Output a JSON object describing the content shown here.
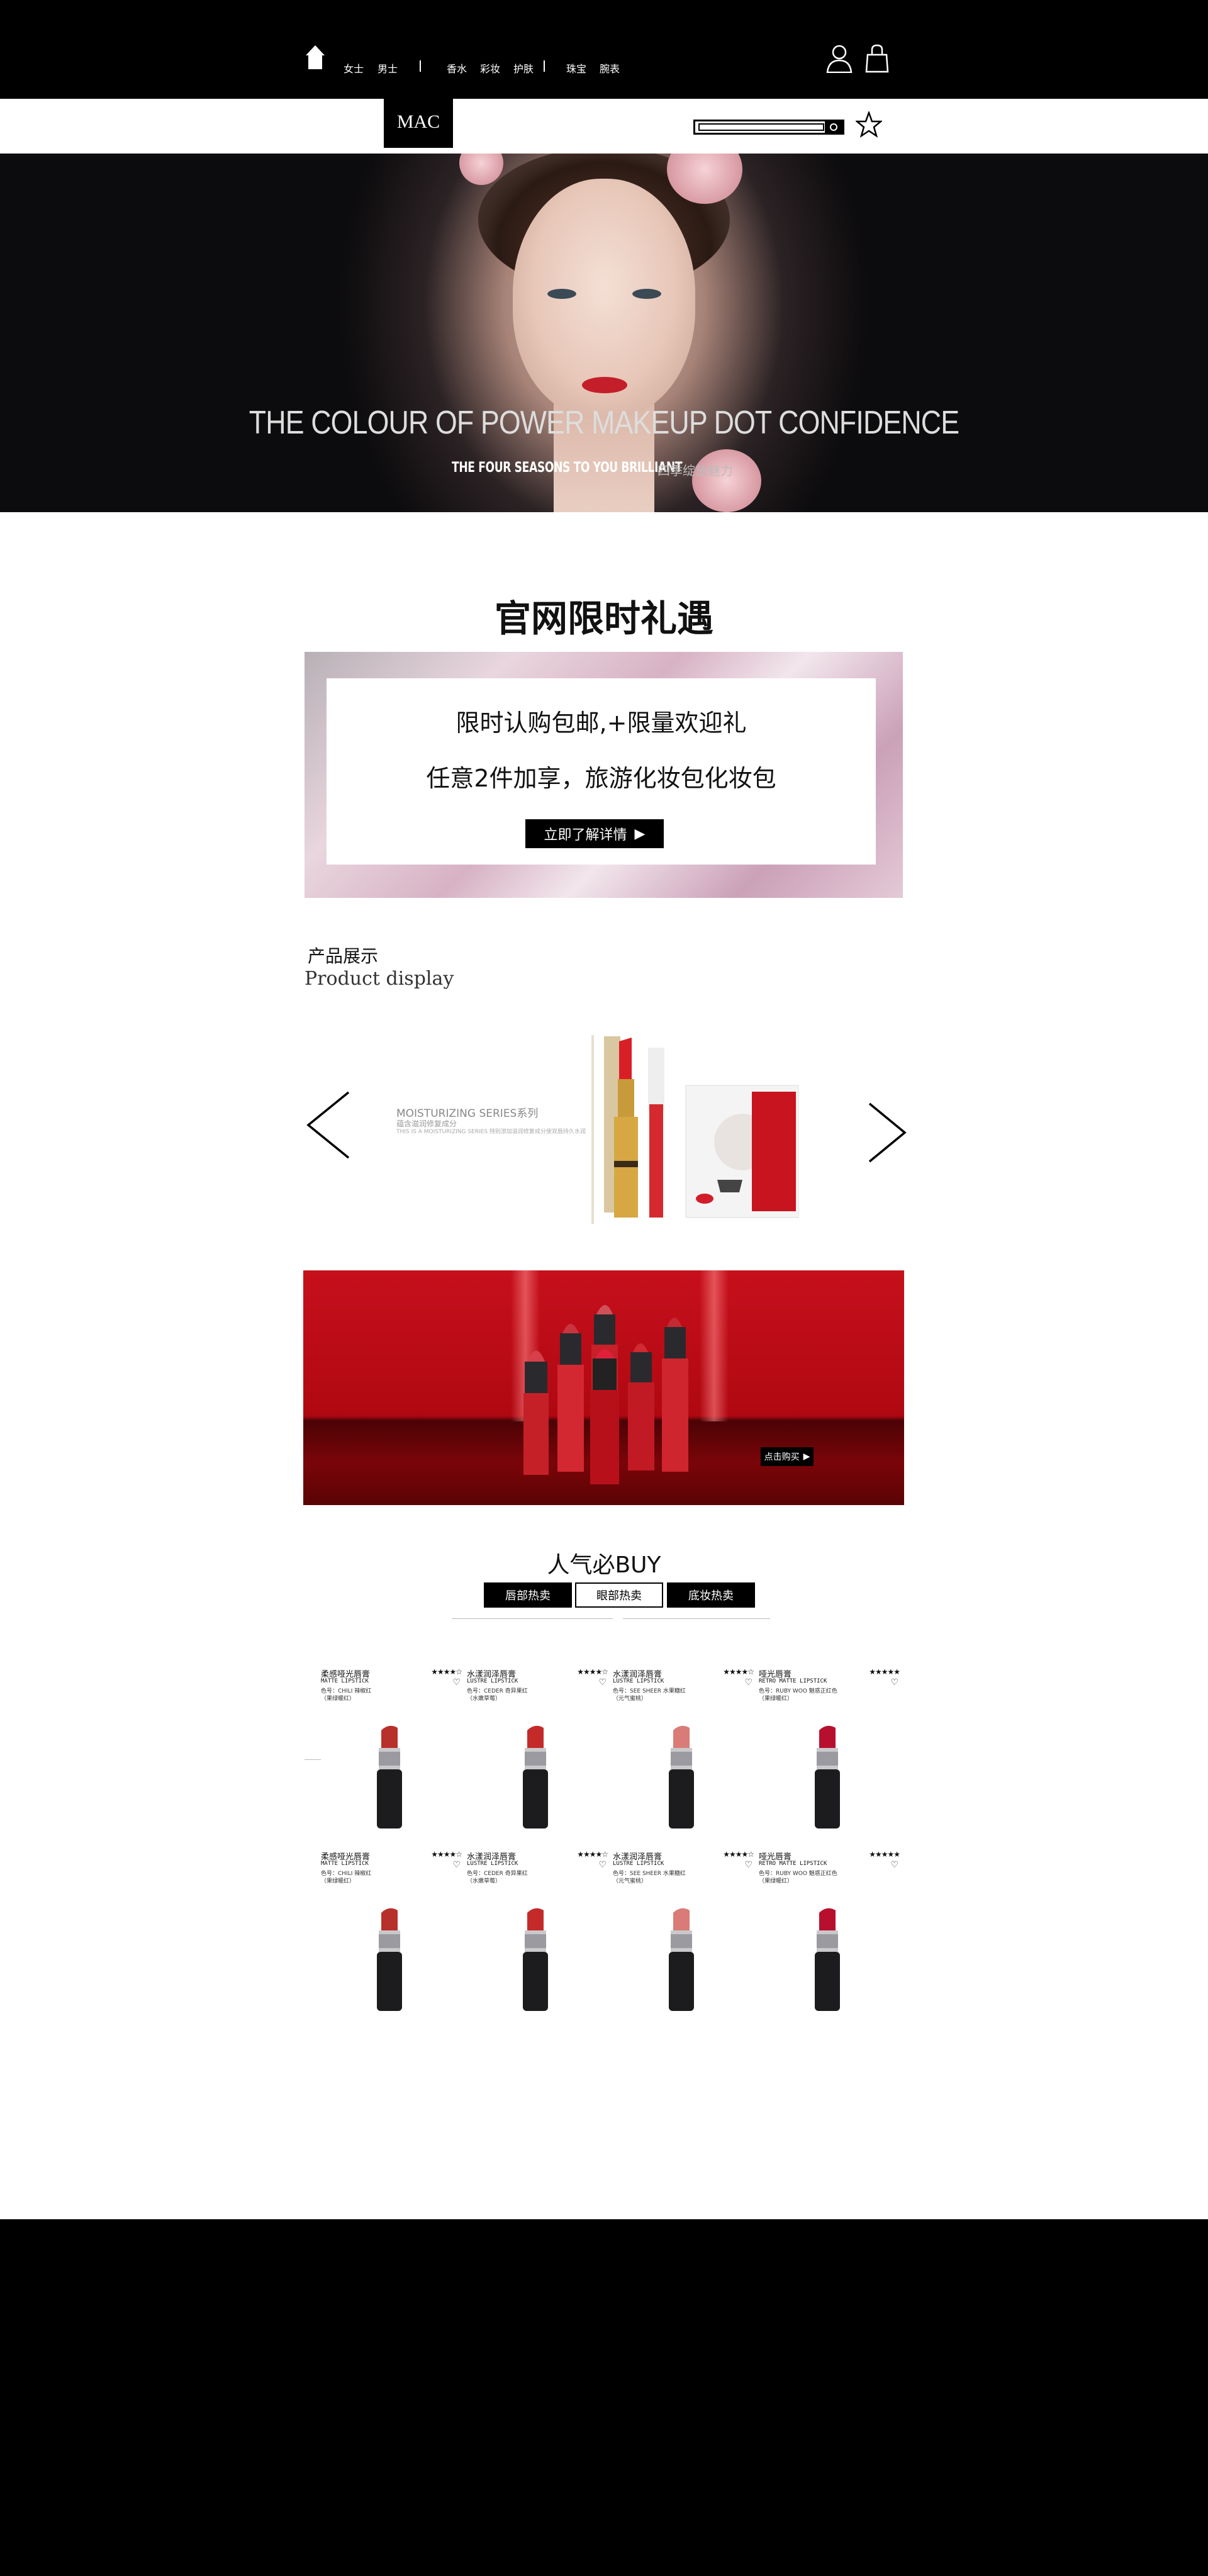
{
  "nav": {
    "women": "女士",
    "men": "男士",
    "perfume": "香水",
    "makeup": "彩妆",
    "skincare": "护肤",
    "jewelry": "珠宝",
    "watches": "腕表"
  },
  "header": {
    "logo": "MAC"
  },
  "hero": {
    "title": "THE COLOUR OF POWER MAKEUP DOT CONFIDENCE",
    "subtitle": "THE FOUR SEASONS TO YOU BRILLIANT",
    "subtitle_right": "四季绽放魅力"
  },
  "promo": {
    "title": "官网限时礼遇",
    "line1": "限时认购包邮,+限量欢迎礼",
    "line2": "任意2件加享，旅游化妆包化妆包",
    "button": "立即了解详情",
    "button_icon": "▶"
  },
  "product_display": {
    "title_cn": "产品展示",
    "title_en": "Product display",
    "carousel_title": "MOISTURIZING SERIES系列",
    "carousel_sub": "蕴含滋润修复成分",
    "carousel_desc": "THIS IS A MOISTURIZING SERIES 特别添加滋润修复成分使双唇持久水润"
  },
  "red_banner": {
    "button": "点击购买",
    "button_icon": "▶"
  },
  "popular": {
    "title": "人气必BUY",
    "tabs": [
      "唇部热卖",
      "眼部热卖",
      "底妆热卖"
    ],
    "products": [
      {
        "name": "柔感哑光唇膏",
        "en": "MATTE LIPSTICK",
        "d1": "色号：CHILI 辣椒红",
        "d2": "（果绿暖红）",
        "stars": "★★★★☆",
        "color": "#b8302a"
      },
      {
        "name": "水漾润泽唇膏",
        "en": "LUSTRE LIPSTICK",
        "d1": "色号：CEDER 奇异果红",
        "d2": "（水嫩草莓）",
        "stars": "★★★★☆",
        "color": "#c42a2a"
      },
      {
        "name": "水漾润泽唇膏",
        "en": "LUSTRE LIPSTICK",
        "d1": "色号：SEE SHEER 水果糖红",
        "d2": "（元气蜜桃）",
        "stars": "★★★★☆",
        "color": "#d97c77"
      },
      {
        "name": "哑光唇膏",
        "en": "RETRO MATTE LIPSTICK",
        "d1": "色号：RUBY WOO 魅惑正红色",
        "d2": "（果绿暖红）",
        "stars": "★★★★★",
        "color": "#b80f2e"
      },
      {
        "name": "柔感哑光唇膏",
        "en": "MATTE LIPSTICK",
        "d1": "色号：CHILI 辣椒红",
        "d2": "（果绿暖红）",
        "stars": "★★★★☆",
        "color": "#b8302a"
      },
      {
        "name": "水漾润泽唇膏",
        "en": "LUSTRE LIPSTICK",
        "d1": "色号：CEDER 奇异果红",
        "d2": "（水嫩草莓）",
        "stars": "★★★★☆",
        "color": "#c42a2a"
      },
      {
        "name": "水漾润泽唇膏",
        "en": "LUSTRE LIPSTICK",
        "d1": "色号：SEE SHEER 水果糖红",
        "d2": "（元气蜜桃）",
        "stars": "★★★★☆",
        "color": "#d97c77"
      },
      {
        "name": "哑光唇膏",
        "en": "RETRO MATTE LIPSTICK",
        "d1": "色号：RUBY WOO 魅惑正红色",
        "d2": "（果绿暖红）",
        "stars": "★★★★★",
        "color": "#b80f2e"
      }
    ],
    "heart_icon": "♡"
  },
  "colors": {
    "topbar": "#000000",
    "footer": "#000000",
    "banner_red": "#c6101c"
  }
}
